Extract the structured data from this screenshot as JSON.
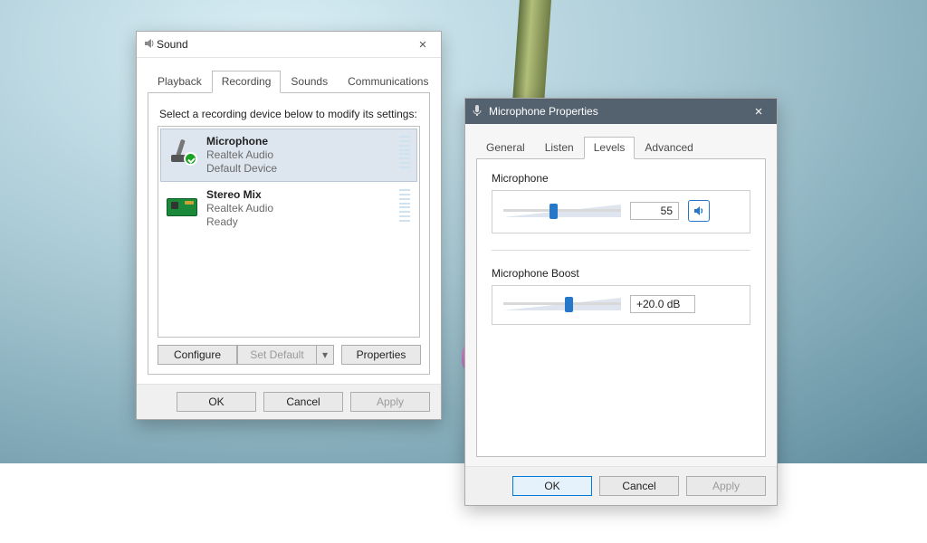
{
  "sound_dialog": {
    "title": "Sound",
    "tabs": {
      "playback": "Playback",
      "recording": "Recording",
      "sounds": "Sounds",
      "communications": "Communications"
    },
    "active_tab": "recording",
    "instruction": "Select a recording device below to modify its settings:",
    "devices": [
      {
        "name": "Microphone",
        "driver": "Realtek Audio",
        "status": "Default Device",
        "selected": true,
        "icon": "microphone",
        "default": true
      },
      {
        "name": "Stereo Mix",
        "driver": "Realtek Audio",
        "status": "Ready",
        "selected": false,
        "icon": "pcb",
        "default": false
      }
    ],
    "buttons": {
      "configure": "Configure",
      "set_default": "Set Default",
      "properties": "Properties",
      "ok": "OK",
      "cancel": "Cancel",
      "apply": "Apply"
    }
  },
  "props_dialog": {
    "title": "Microphone Properties",
    "tabs": {
      "general": "General",
      "listen": "Listen",
      "levels": "Levels",
      "advanced": "Advanced"
    },
    "active_tab": "levels",
    "mic_level": {
      "label": "Microphone",
      "value": "55",
      "pct": 42,
      "muted": false
    },
    "mic_boost": {
      "label": "Microphone Boost",
      "value": "+20.0 dB",
      "pct": 55
    },
    "buttons": {
      "ok": "OK",
      "cancel": "Cancel",
      "apply": "Apply"
    }
  }
}
